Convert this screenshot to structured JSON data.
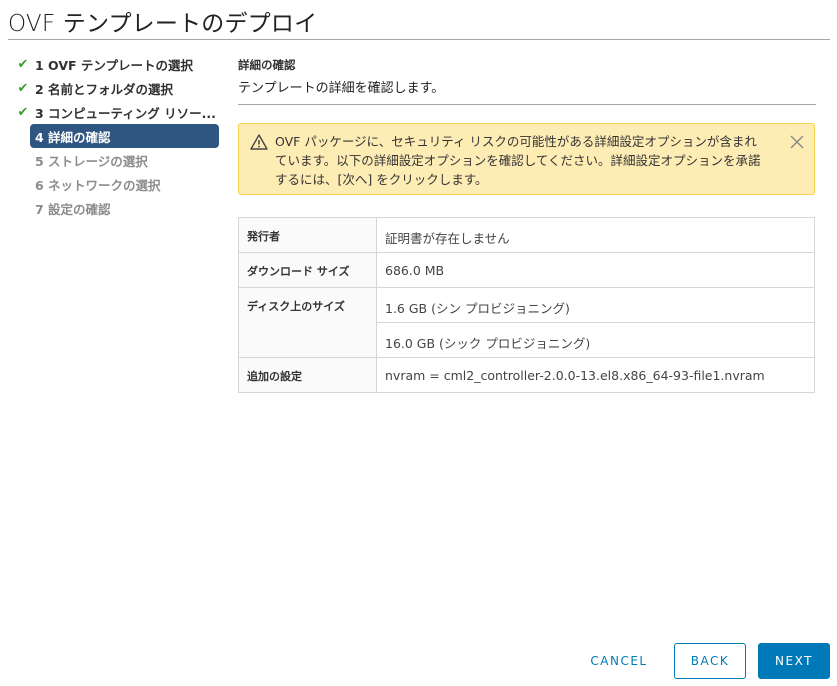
{
  "window": {
    "title": "OVF テンプレートのデプロイ"
  },
  "steps": [
    {
      "label": "1 OVF テンプレートの選択",
      "state": "completed",
      "icon": "check-icon"
    },
    {
      "label": "2 名前とフォルダの選択",
      "state": "completed",
      "icon": "check-icon"
    },
    {
      "label": "3 コンピューティング リソー...",
      "state": "completed",
      "icon": "check-icon"
    },
    {
      "label": "4 詳細の確認",
      "state": "active"
    },
    {
      "label": "5 ストレージの選択",
      "state": "disabled"
    },
    {
      "label": "6 ネットワークの選択",
      "state": "disabled"
    },
    {
      "label": "7 設定の確認",
      "state": "disabled"
    }
  ],
  "main": {
    "section_title": "詳細の確認",
    "section_subtitle": "テンプレートの詳細を確認します。",
    "alert": {
      "icon": "warning-icon",
      "text": "OVF パッケージに、セキュリティ リスクの可能性がある詳細設定オプションが含まれています。以下の詳細設定オプションを確認してください。詳細設定オプションを承諾するには、[次へ] をクリックします。",
      "close_icon": "close-icon"
    },
    "details": {
      "publisher_label": "発行者",
      "publisher_value": "証明書が存在しません",
      "download_size_label": "ダウンロード サイズ",
      "download_size_value": "686.0 MB",
      "disk_size_label": "ディスク上のサイズ",
      "disk_size_thin": "1.6 GB (シン プロビジョニング)",
      "disk_size_thick": "16.0 GB (シック プロビジョニング)",
      "extra_config_label": "追加の設定",
      "extra_config_value": "nvram = cml2_controller-2.0.0-13.el8.x86_64-93-file1.nvram"
    }
  },
  "footer": {
    "cancel_label": "CANCEL",
    "back_label": "BACK",
    "next_label": "NEXT"
  },
  "colors": {
    "accent": "#0079b8",
    "active_step": "#2f5581",
    "check": "#3f9c35",
    "alert_bg": "#feecb5",
    "alert_border": "#f5d250"
  }
}
